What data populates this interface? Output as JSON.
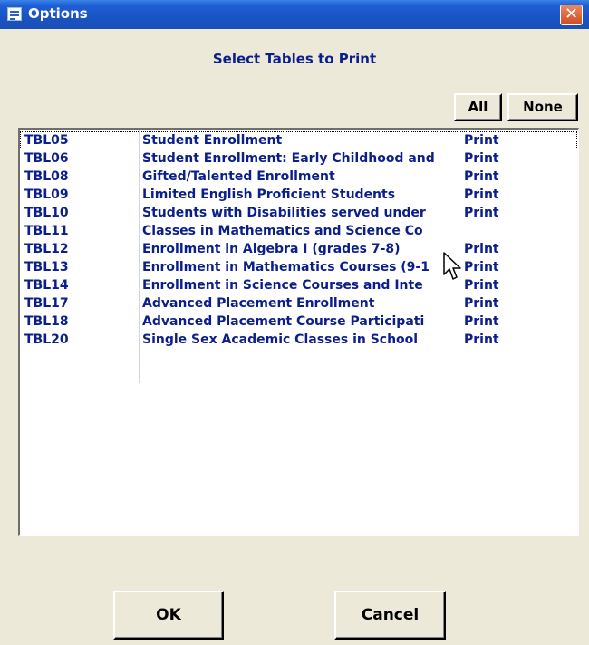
{
  "window": {
    "title": "Options",
    "close_glyph": "✕",
    "title_icon": "form-icon",
    "close_icon": "close-x-icon"
  },
  "dialog": {
    "heading": "Select Tables to Print",
    "all_label": "All",
    "none_label": "None",
    "ok_label": "OK",
    "ok_mnemonic": "O",
    "ok_rest": "K",
    "cancel_label": "Cancel",
    "cancel_mnemonic": "C",
    "cancel_rest": "ancel"
  },
  "tables": [
    {
      "id": "TBL05",
      "name": "Student Enrollment",
      "status": "Print"
    },
    {
      "id": "TBL06",
      "name": "Student Enrollment: Early Childhood and",
      "status": "Print"
    },
    {
      "id": "TBL08",
      "name": "Gifted/Talented Enrollment",
      "status": "Print"
    },
    {
      "id": "TBL09",
      "name": "Limited English Proficient Students",
      "status": "Print"
    },
    {
      "id": "TBL10",
      "name": "Students with Disabilities served under",
      "status": "Print"
    },
    {
      "id": "TBL11",
      "name": "Classes in Mathematics and Science Co",
      "status": ""
    },
    {
      "id": "TBL12",
      "name": "Enrollment in Algebra I (grades 7-8)",
      "status": "Print"
    },
    {
      "id": "TBL13",
      "name": "Enrollment in Mathematics Courses (9-1",
      "status": "Print"
    },
    {
      "id": "TBL14",
      "name": "Enrollment in Science Courses and Inte",
      "status": "Print"
    },
    {
      "id": "TBL17",
      "name": "Advanced Placement Enrollment",
      "status": "Print"
    },
    {
      "id": "TBL18",
      "name": "Advanced Placement Course Participati",
      "status": "Print"
    },
    {
      "id": "TBL20",
      "name": "Single Sex Academic Classes in School",
      "status": "Print"
    }
  ],
  "colors": {
    "title_bar": "#1f5fd4",
    "text_accent": "#0b1f8c",
    "dialog_bg": "#ece9d8",
    "close_button": "#cf4d22"
  }
}
